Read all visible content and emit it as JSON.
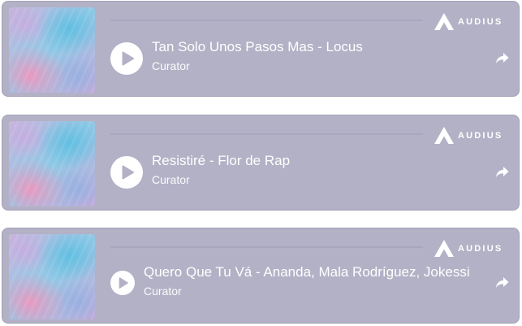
{
  "brand": {
    "name": "AUDIUS",
    "logo_icon": "audius-logo-icon"
  },
  "icons": {
    "play": "play-icon",
    "share": "share-icon"
  },
  "colors": {
    "card_background": "#b3b1c6",
    "text": "#ffffff",
    "button": "#ffffff"
  },
  "tracks": [
    {
      "title": "Tan Solo Unos Pasos Mas - Locus",
      "artist": "Curator",
      "play_label": "Play",
      "share_label": "Share"
    },
    {
      "title": "Resistiré - Flor de Rap",
      "artist": "Curator",
      "play_label": "Play",
      "share_label": "Share"
    },
    {
      "title": "Quero Que Tu Vá - Ananda, Mala Rodríguez, Jokessi",
      "artist": "Curator",
      "play_label": "Play",
      "share_label": "Share"
    }
  ]
}
